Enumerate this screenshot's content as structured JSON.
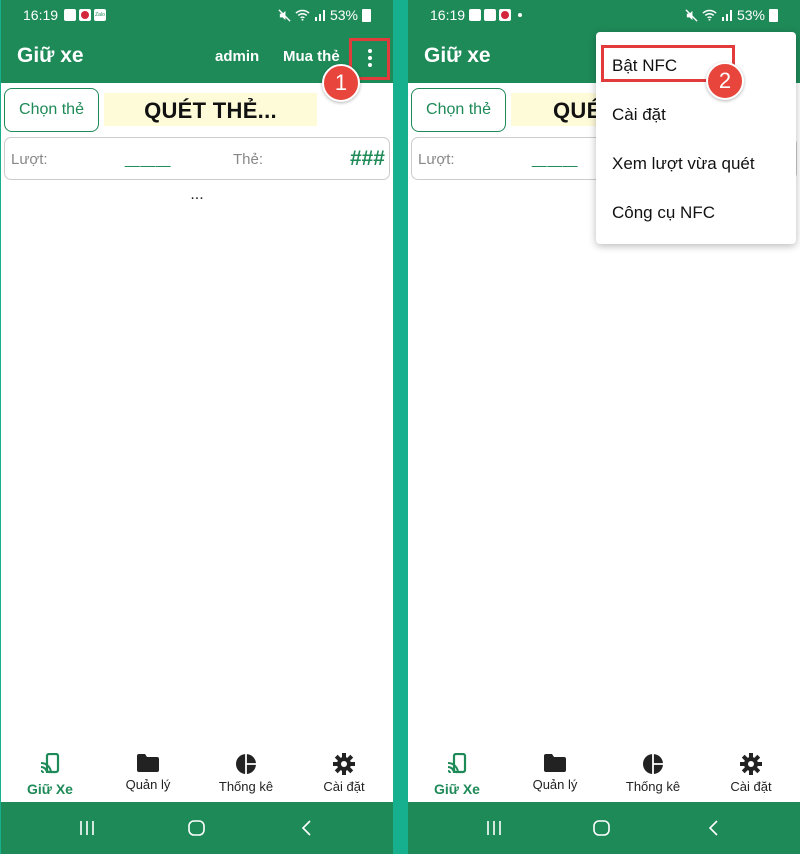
{
  "status": {
    "time": "16:19",
    "battery": "53%"
  },
  "appbar": {
    "title": "Giữ xe",
    "user": "admin",
    "buy_card": "Mua thẻ"
  },
  "main": {
    "choose_card_button": "Chọn thẻ",
    "scan_banner": "QUÉT THẺ...",
    "luot_label": "Lượt:",
    "luot_value": "___",
    "the_label": "Thẻ:",
    "the_value": "###",
    "loading": "..."
  },
  "bottom_nav": [
    {
      "label": "Giữ Xe",
      "icon": "nfc-phone-icon",
      "active": true
    },
    {
      "label": "Quản lý",
      "icon": "folder-icon",
      "active": false
    },
    {
      "label": "Thống kê",
      "icon": "pie-chart-icon",
      "active": false
    },
    {
      "label": "Cài đặt",
      "icon": "gear-icon",
      "active": false
    }
  ],
  "overflow_menu": {
    "items": [
      "Bật NFC",
      "Cài đặt",
      "Xem lượt vừa quét",
      "Công cụ NFC"
    ]
  },
  "steps": {
    "step1": "1",
    "step2": "2"
  },
  "colors": {
    "primary": "#1e8a58",
    "highlight": "#e13b3b",
    "banner": "#fefbd8",
    "divider": "#16b08f"
  }
}
